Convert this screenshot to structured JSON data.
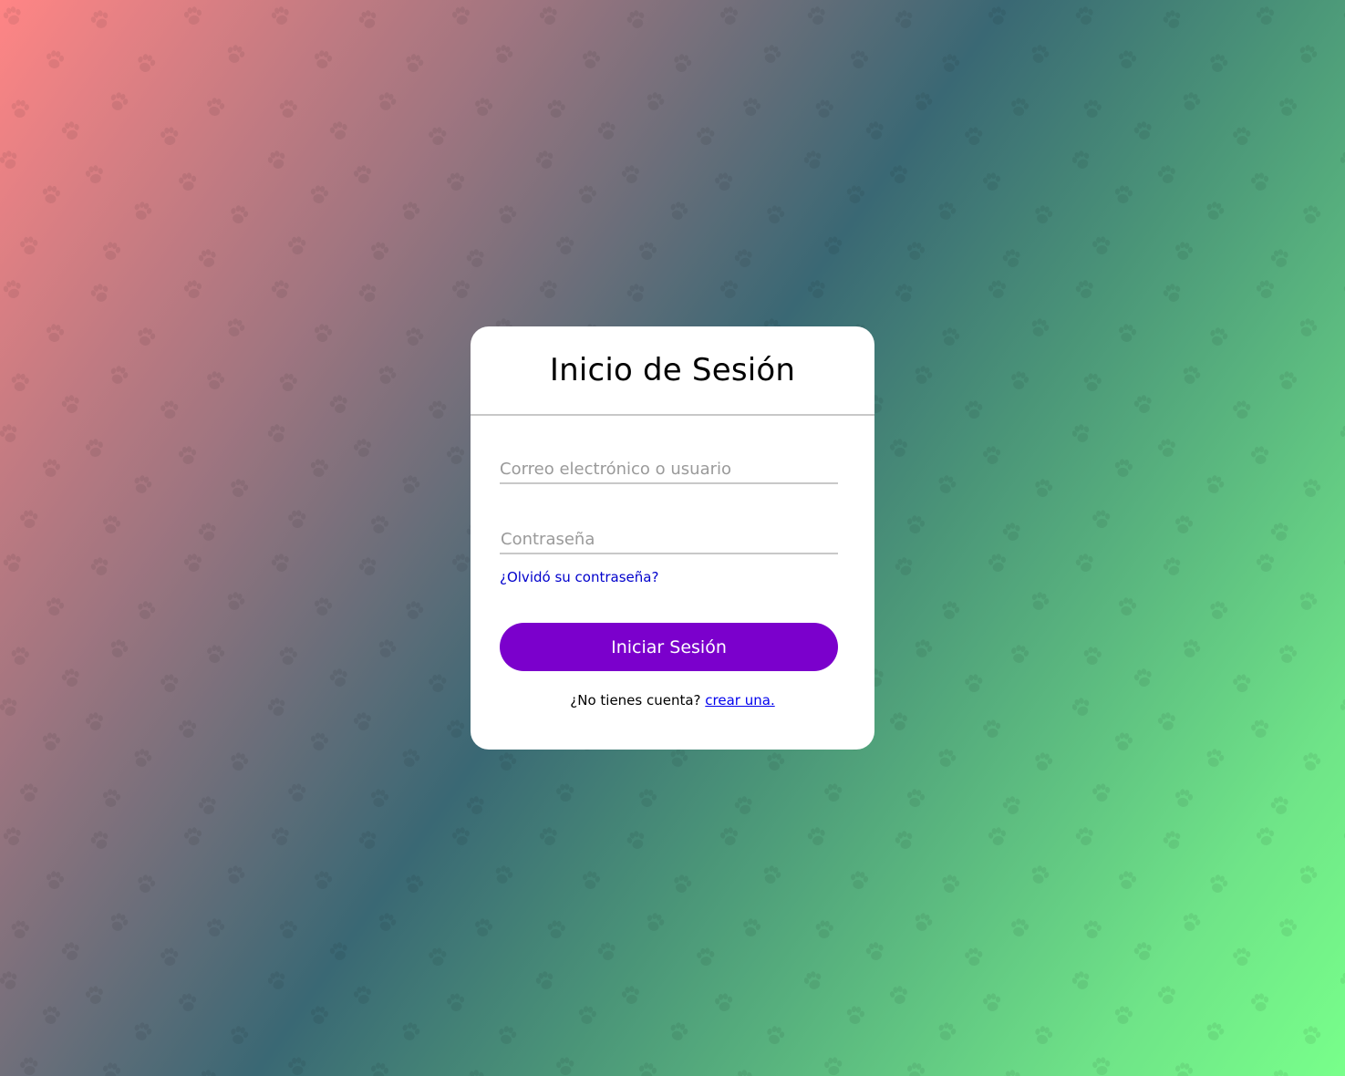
{
  "login": {
    "title": "Inicio de Sesión",
    "email_placeholder": "Correo electrónico o usuario",
    "password_placeholder": "Contraseña",
    "forgot_label": "¿Olvidó su contraseña?",
    "submit_label": "Iniciar Sesión",
    "signup_prompt": "¿No tienes cuenta?",
    "signup_link": "crear una."
  },
  "colors": {
    "accent": "#7b00cc",
    "link": "#0000cc",
    "gradient_start": "#ff8585",
    "gradient_mid": "#3a6874",
    "gradient_end": "#78ff8a"
  },
  "background": {
    "pattern_icon": "paw-icon"
  }
}
